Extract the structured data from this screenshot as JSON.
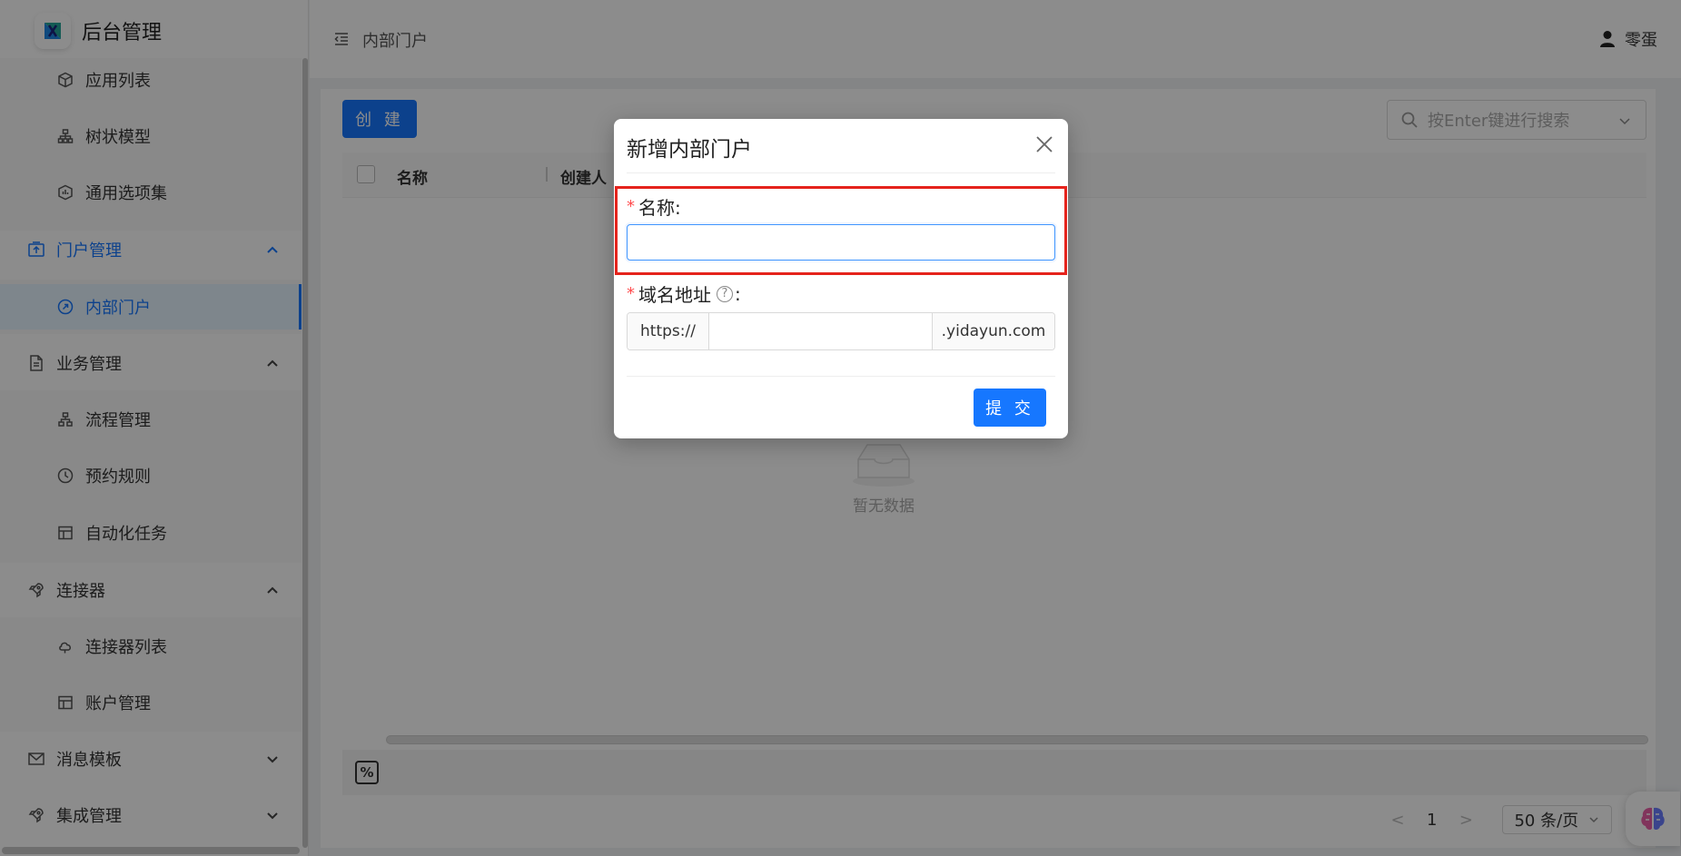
{
  "app": {
    "title": "后台管理"
  },
  "sidebar": {
    "items": [
      {
        "label": "应用列表",
        "icon": "cube-icon"
      },
      {
        "label": "树状模型",
        "icon": "tree-icon"
      },
      {
        "label": "通用选项集",
        "icon": "option-set-icon"
      },
      {
        "label": "门户管理",
        "icon": "portal-icon",
        "group": true,
        "expanded": true
      },
      {
        "label": "内部门户",
        "icon": "link-icon",
        "selected": true
      },
      {
        "label": "业务管理",
        "icon": "document-icon",
        "group": true,
        "expanded": true
      },
      {
        "label": "流程管理",
        "icon": "flow-icon"
      },
      {
        "label": "预约规则",
        "icon": "clock-icon"
      },
      {
        "label": "自动化任务",
        "icon": "table-icon"
      },
      {
        "label": "连接器",
        "icon": "rocket-icon",
        "group": true,
        "expanded": true
      },
      {
        "label": "连接器列表",
        "icon": "cloud-icon"
      },
      {
        "label": "账户管理",
        "icon": "table-icon"
      },
      {
        "label": "消息模板",
        "icon": "mail-icon",
        "group": true,
        "expanded": false
      },
      {
        "label": "集成管理",
        "icon": "rocket-icon",
        "group": true,
        "expanded": false
      }
    ]
  },
  "header": {
    "breadcrumb": "内部门户",
    "user": "零蛋"
  },
  "toolbar": {
    "create_label": "创 建",
    "search_placeholder": "按Enter键进行搜索"
  },
  "table": {
    "columns": [
      "名称",
      "创建人"
    ],
    "empty_text": "暂无数据"
  },
  "pagination": {
    "current": "1",
    "page_size": "50 条/页"
  },
  "modal": {
    "title": "新增内部门户",
    "name_label": "名称:",
    "domain_label": "域名地址",
    "domain_colon": ":",
    "domain_prefix": "https://",
    "domain_suffix": ".yidayun.com",
    "submit_label": "提 交",
    "required_mark": "*"
  },
  "colors": {
    "primary": "#1677ff",
    "highlight": "#e5231c",
    "required": "#ff4d4f"
  }
}
